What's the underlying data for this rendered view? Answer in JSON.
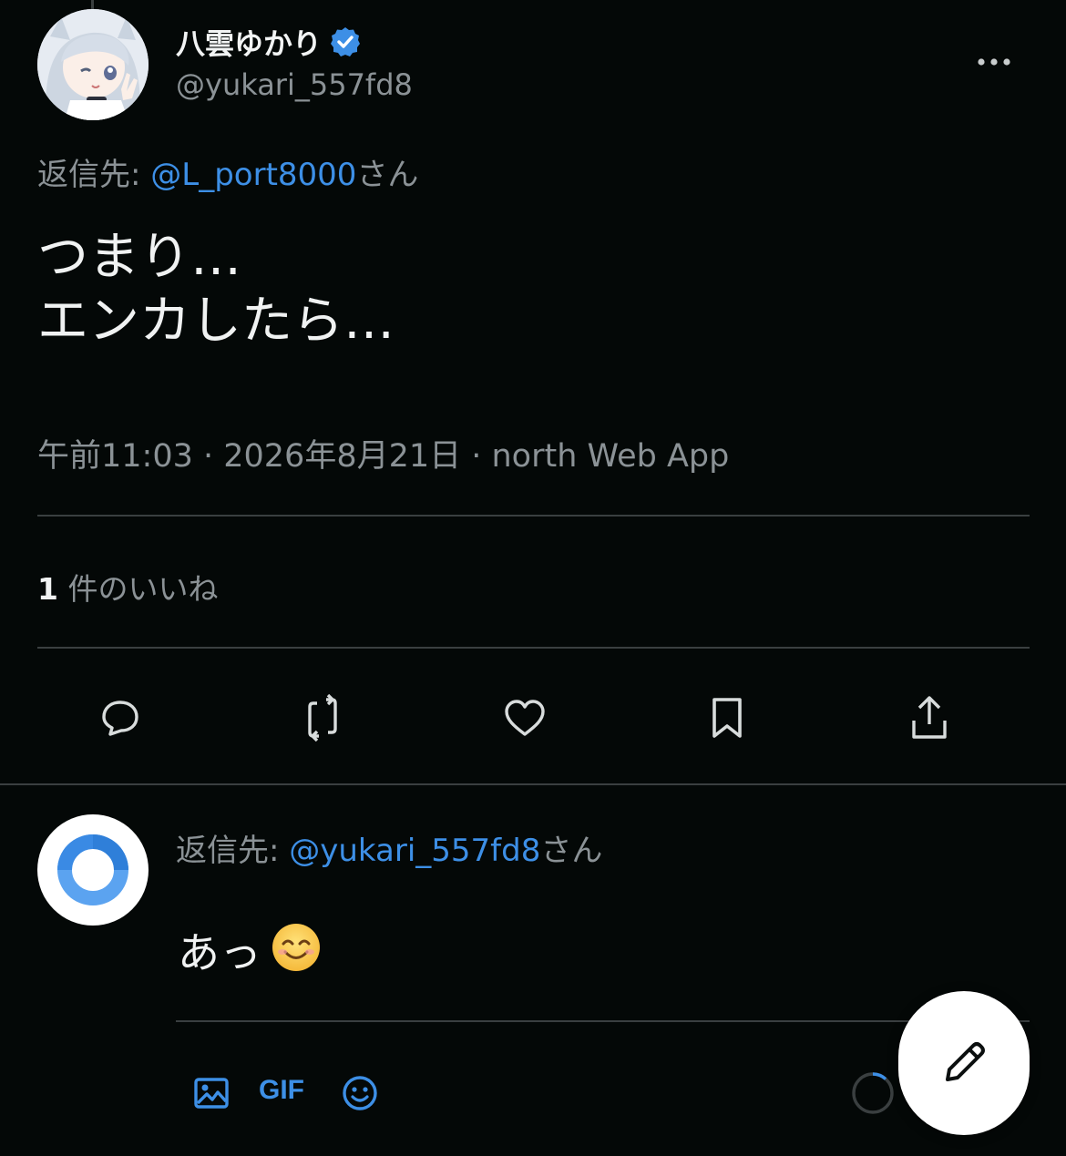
{
  "tweet": {
    "author": {
      "display_name": "八雲ゆかり",
      "handle": "@yukari_557fd8",
      "verified": true
    },
    "reply_to": {
      "prefix": "返信先: ",
      "mention": "@L_port8000",
      "suffix": "さん"
    },
    "text": "つまり…\nエンカしたら…",
    "meta": "午前11:03 · 2026年8月21日 · north Web App",
    "likes": {
      "count": "1",
      "label": " 件のいいね"
    }
  },
  "actions": [
    "reply-icon",
    "retweet-icon",
    "like-icon",
    "bookmark-icon",
    "share-icon"
  ],
  "composer": {
    "reply_to": {
      "prefix": "返信先: ",
      "mention": "@yukari_557fd8",
      "suffix": "さん"
    },
    "text": "あっ",
    "emoji": "😊",
    "gif_label": "GIF",
    "toolbar": [
      "image-icon",
      "gif-button",
      "emoji-icon",
      "character-progress-ring"
    ]
  },
  "colors": {
    "background": "#040807",
    "accent": "#3d8fe6",
    "muted_text": "#8b9296",
    "divider": "#3a3f40"
  }
}
